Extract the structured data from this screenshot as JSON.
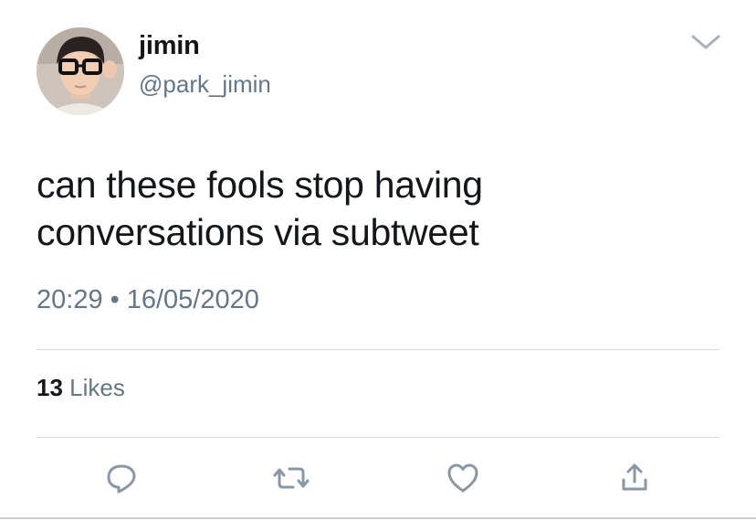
{
  "user": {
    "display_name": "jimin",
    "handle": "@park_jimin",
    "avatar_icon": "profile-photo"
  },
  "tweet": {
    "text": "can these fools stop having conversations via subtweet",
    "time": "20:29",
    "separator": "•",
    "date": "16/05/2020"
  },
  "stats": {
    "likes_count": "13",
    "likes_label": "Likes"
  },
  "actions": [
    {
      "icon": "reply-icon"
    },
    {
      "icon": "retweet-icon"
    },
    {
      "icon": "like-icon"
    },
    {
      "icon": "share-icon"
    }
  ],
  "colors": {
    "primary_text": "#14171a",
    "secondary_text": "#657786",
    "divider": "#d6d9dc",
    "icon": "#657786"
  }
}
